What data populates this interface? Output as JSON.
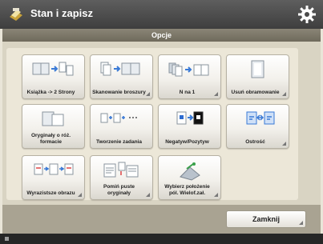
{
  "app": {
    "title": "Stan i zapisz",
    "icon": "scanner-folder-icon"
  },
  "section": {
    "title": "Opcje"
  },
  "tiles": [
    {
      "label": "Książka -> 2 Strony",
      "icon": "book-to-two-pages-icon"
    },
    {
      "label": "Skanowanie broszury",
      "icon": "booklet-scan-icon"
    },
    {
      "label": "N na 1",
      "icon": "n-on-1-icon"
    },
    {
      "label": "Usuń obramowanie",
      "icon": "erase-frame-icon"
    },
    {
      "label": "Oryginały o róż. formacie",
      "icon": "mixed-size-originals-icon"
    },
    {
      "label": "Tworzenie zadania",
      "icon": "job-build-icon"
    },
    {
      "label": "Negatyw/Pozytyw",
      "icon": "negative-positive-icon"
    },
    {
      "label": "Ostrość",
      "icon": "sharpness-icon"
    },
    {
      "label": "Wyrazistsze obrazu",
      "icon": "clearer-image-icon"
    },
    {
      "label": "Pomiń puste oryginały",
      "icon": "skip-blank-originals-icon"
    },
    {
      "label": "Wybierz położenie pól. Wielof.zał.",
      "icon": "select-line-position-icon"
    }
  ],
  "close_button": {
    "label": "Zamknij"
  },
  "colors": {
    "titlebar": "#4a4a4a",
    "panel": "#d9d4c3",
    "section_bar": "#7c7768",
    "tile_bg": "#f3f1ec",
    "icon_blue": "#3a7ad6",
    "icon_gray": "#9aa4ad"
  }
}
